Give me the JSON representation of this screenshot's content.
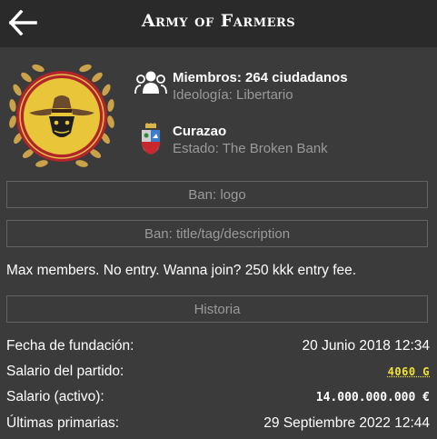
{
  "header": {
    "title": "Army of Farmers",
    "back_icon": "arrow-left-icon"
  },
  "party": {
    "emblem_icon": "cowboy-mask-emblem",
    "members_label": "Miembros: 264 ciudadanos",
    "ideology_label": "Ideología: Libertario",
    "members_icon": "group-icon",
    "country_name": "Curazao",
    "country_icon": "curacao-coat-of-arms-icon",
    "state_label": "Estado: The Broken Bank"
  },
  "buttons": {
    "ban_logo": "Ban: logo",
    "ban_info": "Ban: title/tag/description",
    "history": "Historia"
  },
  "description": "Max members. No entry. Wanna join? 250 kkk entry fee.",
  "stats": [
    {
      "label": "Fecha de fundación:",
      "value": "20 Junio 2018 12:34"
    },
    {
      "label": "Salario del partido:",
      "value": "4060 G"
    },
    {
      "label": "Salario (activo):",
      "value": "14.000.000.000 €"
    },
    {
      "label": "Últimas primarias:",
      "value": "29 Septiembre 2022 12:44"
    }
  ],
  "colors": {
    "background": "#3b3b3b",
    "header": "#2a2a2a",
    "gold": "#f2e233",
    "muted": "#9a9a9a"
  }
}
